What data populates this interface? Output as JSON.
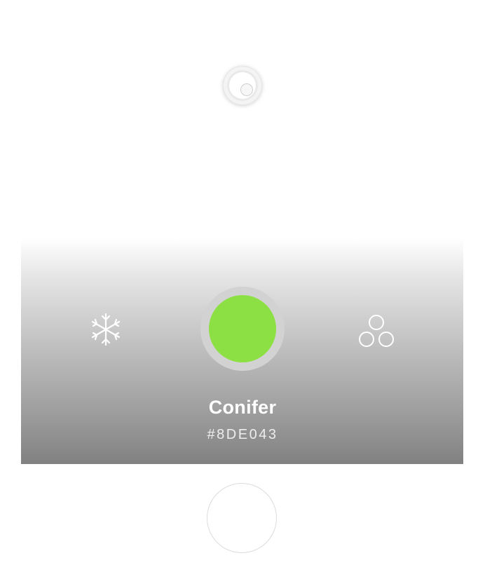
{
  "colors": {
    "swatch": "#8DE043",
    "icon": "#ffffff"
  },
  "icons": {
    "top": "capture-ring-icon",
    "left": "snowflake-icon",
    "right": "three-circles-icon"
  },
  "color_card": {
    "name": "Conifer",
    "hex": "#8DE043"
  }
}
